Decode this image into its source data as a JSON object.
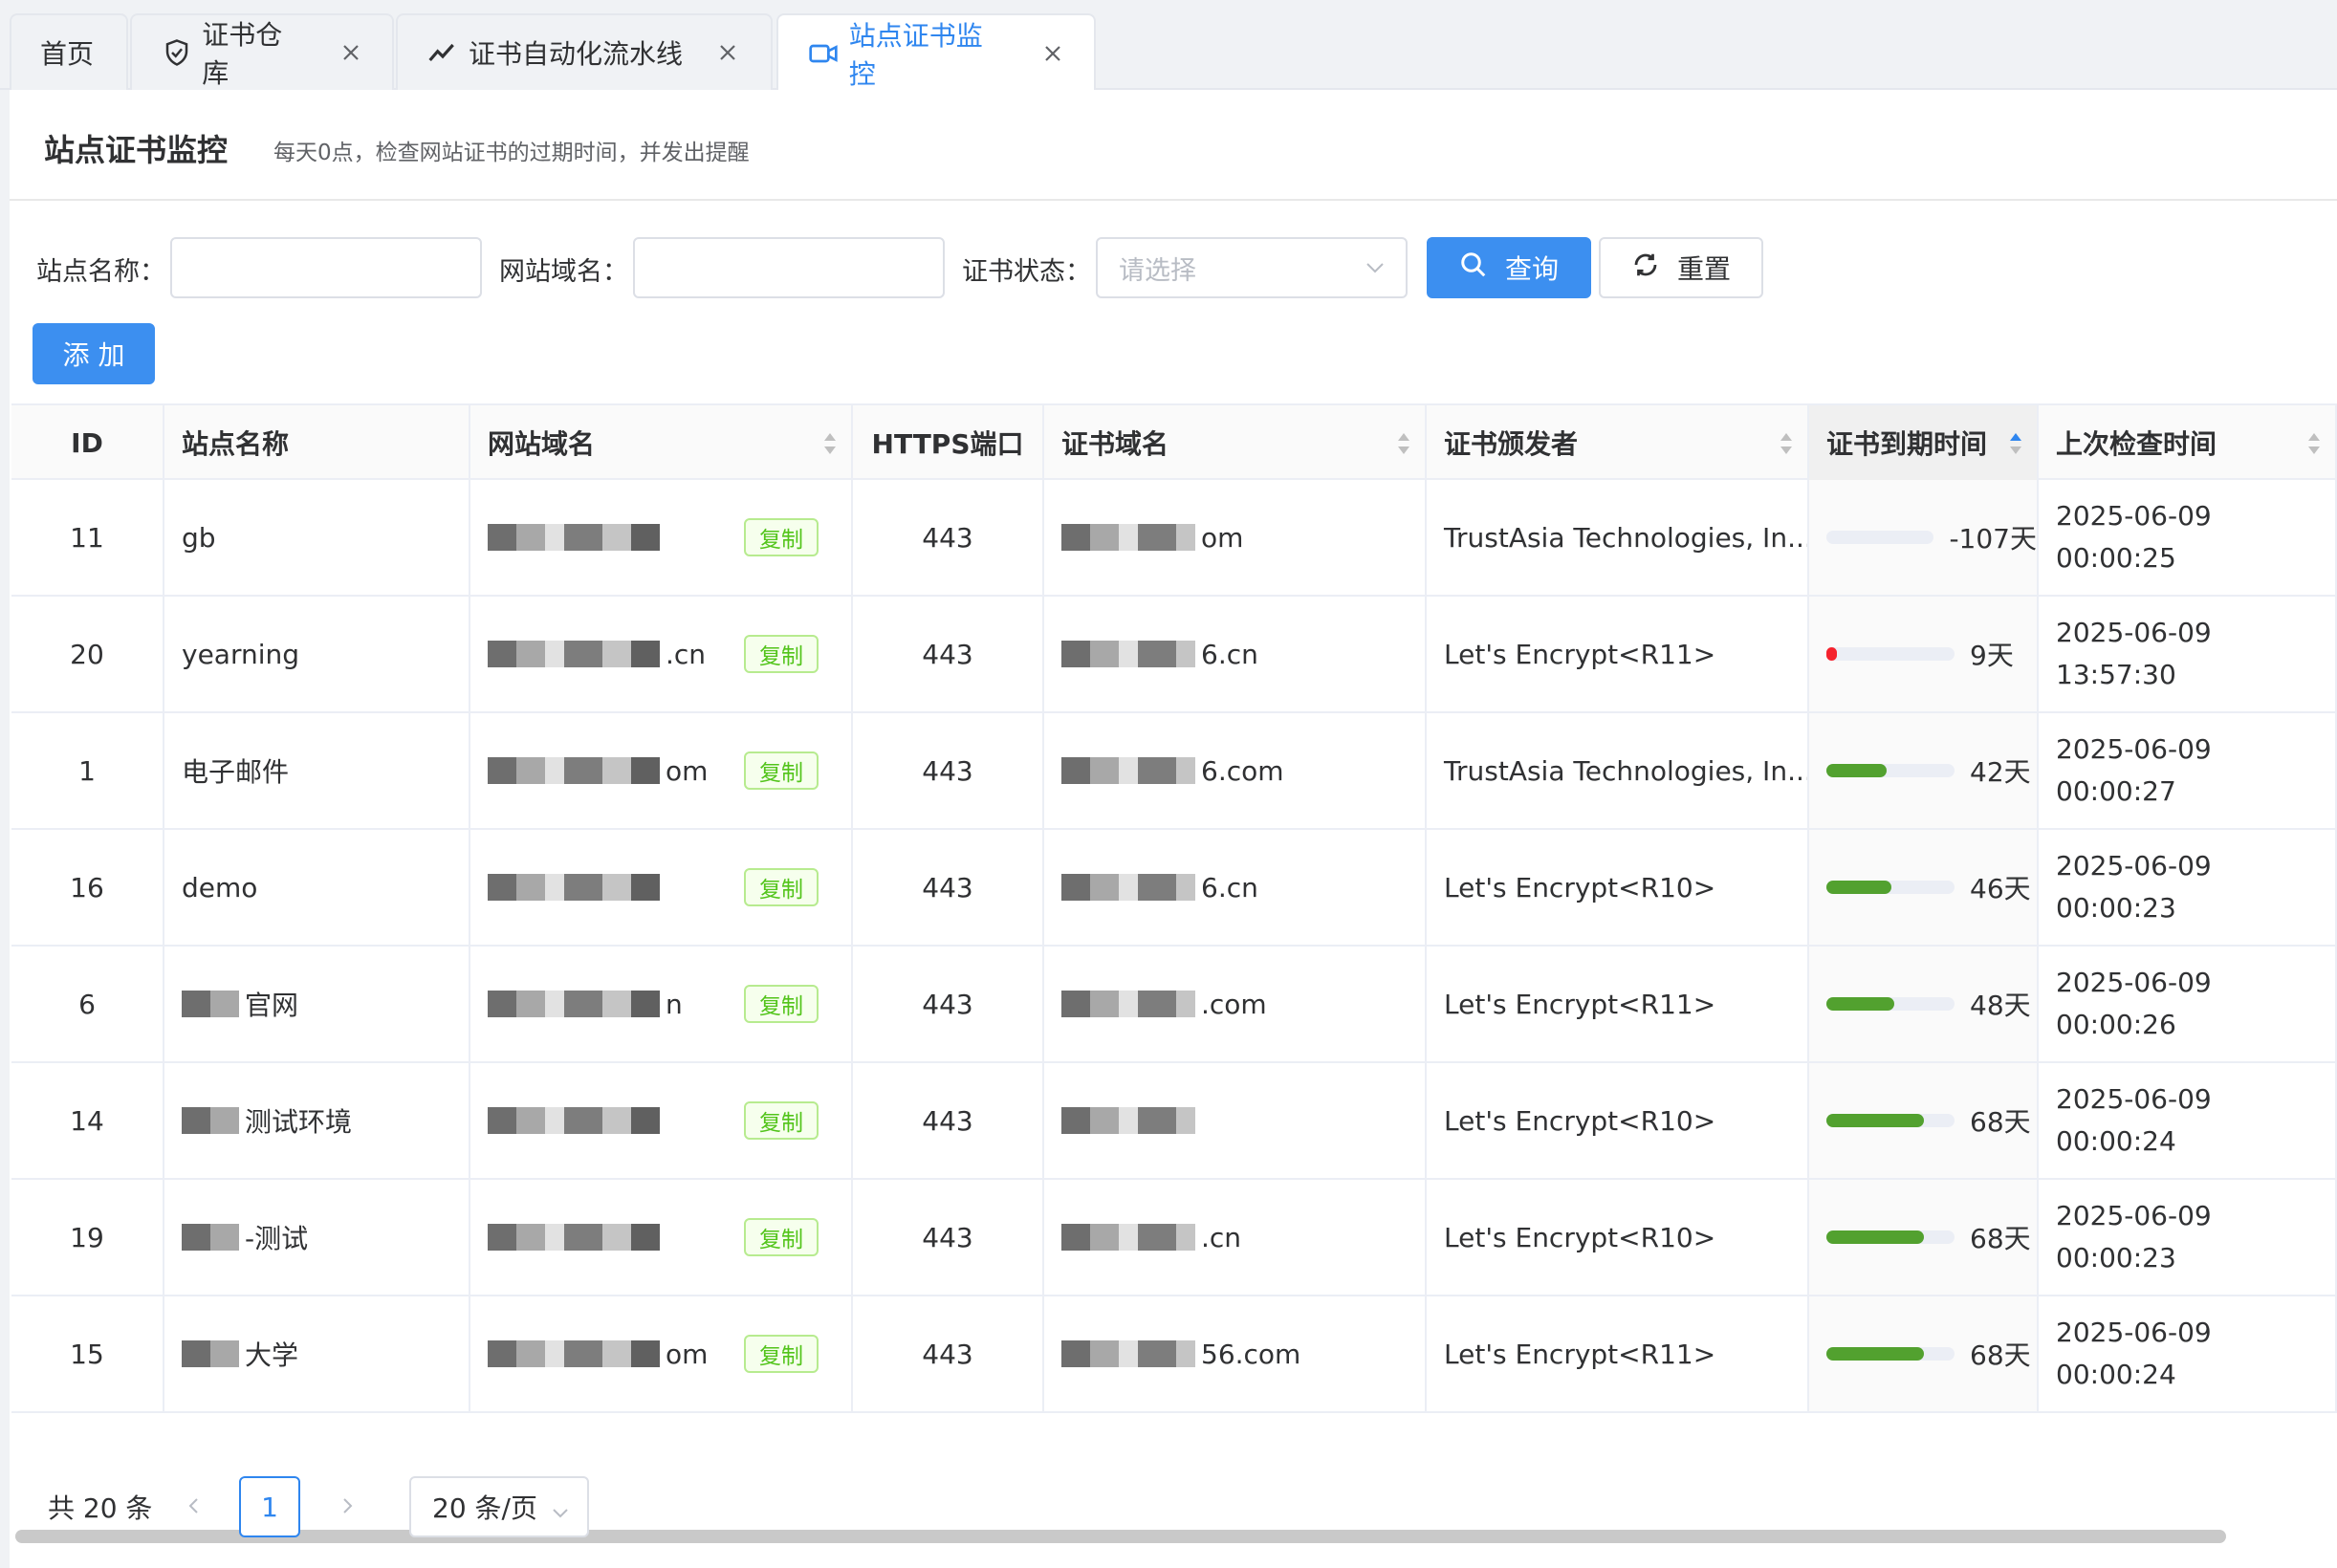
{
  "tabs": [
    {
      "label": "首页"
    },
    {
      "label": "证书仓库"
    },
    {
      "label": "证书自动化流水线"
    },
    {
      "label": "站点证书监控"
    }
  ],
  "header": {
    "title": "站点证书监控",
    "description": "每天0点，检查网站证书的过期时间，并发出提醒"
  },
  "filters": {
    "site_name_label": "站点名称：",
    "domain_label": "网站域名：",
    "status_label": "证书状态：",
    "status_placeholder": "请选择",
    "search_button": "查询",
    "reset_button": "重置",
    "add_button": "添 加"
  },
  "table": {
    "headers": [
      "ID",
      "站点名称",
      "网站域名",
      "HTTPS端口",
      "证书域名",
      "证书颁发者",
      "证书到期时间",
      "上次检查时间"
    ],
    "copy_label": "复制",
    "rows": [
      {
        "id": "11",
        "site": "gb",
        "domain_suffix": "",
        "port": "443",
        "cert_suffix": "om",
        "issuer": "TrustAsia Technologies, In...",
        "days": "-107天",
        "progress": 0,
        "check_date": "2025-06-09",
        "check_time": "00:00:25"
      },
      {
        "id": "20",
        "site": "yearning",
        "domain_suffix": ".cn",
        "port": "443",
        "cert_suffix": "6.cn",
        "issuer": "Let's Encrypt<R11>",
        "days": "9天",
        "progress": 0.06,
        "check_date": "2025-06-09",
        "check_time": "13:57:30"
      },
      {
        "id": "1",
        "site": "电子邮件",
        "domain_suffix": "om",
        "port": "443",
        "cert_suffix": "6.com",
        "issuer": "TrustAsia Technologies, In...",
        "days": "42天",
        "progress": 0.47,
        "check_date": "2025-06-09",
        "check_time": "00:00:27"
      },
      {
        "id": "16",
        "site": "demo",
        "domain_suffix": "",
        "port": "443",
        "cert_suffix": "6.cn",
        "issuer": "Let's Encrypt<R10>",
        "days": "46天",
        "progress": 0.51,
        "check_date": "2025-06-09",
        "check_time": "00:00:23"
      },
      {
        "id": "6",
        "site": "官网",
        "domain_suffix": "n",
        "port": "443",
        "cert_suffix": ".com",
        "issuer": "Let's Encrypt<R11>",
        "days": "48天",
        "progress": 0.53,
        "check_date": "2025-06-09",
        "check_time": "00:00:26"
      },
      {
        "id": "14",
        "site": "测试环境",
        "domain_suffix": "",
        "port": "443",
        "cert_suffix": "",
        "issuer": "Let's Encrypt<R10>",
        "days": "68天",
        "progress": 0.76,
        "check_date": "2025-06-09",
        "check_time": "00:00:24"
      },
      {
        "id": "19",
        "site": "-测试",
        "domain_suffix": "",
        "port": "443",
        "cert_suffix": ".cn",
        "issuer": "Let's Encrypt<R10>",
        "days": "68天",
        "progress": 0.76,
        "check_date": "2025-06-09",
        "check_time": "00:00:23"
      },
      {
        "id": "15",
        "site": "大学",
        "domain_suffix": "om",
        "port": "443",
        "cert_suffix": "56.com",
        "issuer": "Let's Encrypt<R11>",
        "days": "68天",
        "progress": 0.76,
        "check_date": "2025-06-09",
        "check_time": "00:00:24"
      }
    ]
  },
  "pagination": {
    "total": "共 20 条",
    "current_page": "1",
    "page_size": "20 条/页"
  },
  "colors": {
    "accent": "#3c8ff0",
    "danger": "#f5222d",
    "success": "#52a12f",
    "tag_green": "#52c41a"
  }
}
